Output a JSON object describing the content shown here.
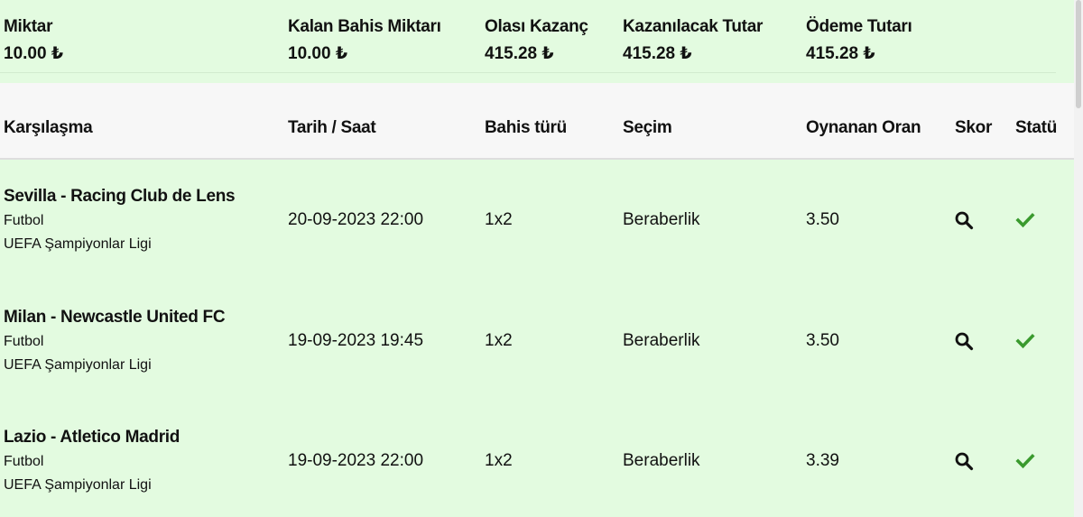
{
  "summary": {
    "items": [
      {
        "label": "Miktar",
        "value": "10.00 ₺"
      },
      {
        "label": "Kalan Bahis Miktarı",
        "value": "10.00 ₺"
      },
      {
        "label": "Olası Kazanç",
        "value": "415.28 ₺"
      },
      {
        "label": "Kazanılacak Tutar",
        "value": "415.28 ₺"
      },
      {
        "label": "Ödeme Tutarı",
        "value": "415.28 ₺"
      }
    ]
  },
  "table": {
    "headers": {
      "match": "Karşılaşma",
      "datetime": "Tarih / Saat",
      "bet_type": "Bahis türü",
      "selection": "Seçim",
      "odds": "Oynanan Oran",
      "score": "Skor",
      "status": "Statü"
    },
    "rows": [
      {
        "match": "Sevilla - Racing Club de Lens",
        "sport": "Futbol",
        "league": "UEFA Şampiyonlar Ligi",
        "datetime": "20-09-2023 22:00",
        "bet_type": "1x2",
        "selection": "Beraberlik",
        "odds": "3.50",
        "score_icon": "search-icon",
        "status_icon": "check-icon"
      },
      {
        "match": "Milan - Newcastle United FC",
        "sport": "Futbol",
        "league": "UEFA Şampiyonlar Ligi",
        "datetime": "19-09-2023 19:45",
        "bet_type": "1x2",
        "selection": "Beraberlik",
        "odds": "3.50",
        "score_icon": "search-icon",
        "status_icon": "check-icon"
      },
      {
        "match": "Lazio - Atletico Madrid",
        "sport": "Futbol",
        "league": "UEFA Şampiyonlar Ligi",
        "datetime": "19-09-2023 22:00",
        "bet_type": "1x2",
        "selection": "Beraberlik",
        "odds": "3.39",
        "score_icon": "search-icon",
        "status_icon": "check-icon"
      }
    ]
  },
  "colors": {
    "panel_bg": "#e3fbe0",
    "header_bg": "#f7f7f7",
    "status_won": "#3a9a2e",
    "text": "#111111"
  }
}
